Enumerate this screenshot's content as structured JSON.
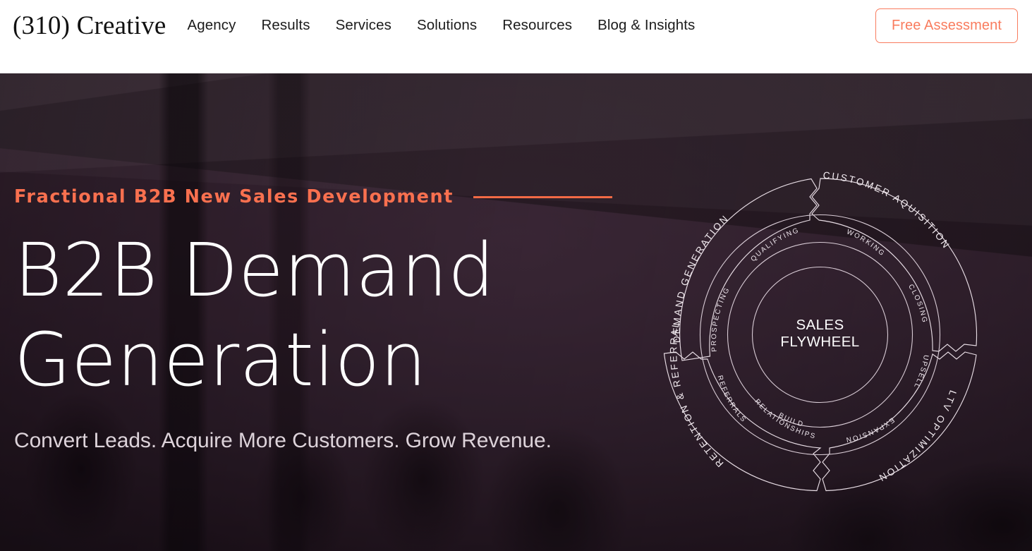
{
  "header": {
    "logo": "(310) Creative",
    "nav": [
      {
        "label": "Agency"
      },
      {
        "label": "Results"
      },
      {
        "label": "Services"
      },
      {
        "label": "Solutions"
      },
      {
        "label": "Resources"
      },
      {
        "label": "Blog & Insights"
      }
    ],
    "cta_label": "Free Assessment"
  },
  "hero": {
    "eyebrow": "Fractional B2B New Sales Development",
    "title_line1": "B2B Demand",
    "title_line2": "Generation",
    "subheading": "Convert Leads. Acquire More Customers. Grow Revenue."
  },
  "flywheel": {
    "center_line1": "SALES",
    "center_line2": "FLYWHEEL",
    "outer_segments": [
      {
        "label": "DEMAND GENERATION"
      },
      {
        "label": "CUSTOMER AQUISITION"
      },
      {
        "label": "LTV OPTIMIZATION"
      },
      {
        "label": "RETENTION & REFERRAL"
      }
    ],
    "inner_stages": [
      {
        "label": "PROSPECTING"
      },
      {
        "label": "QUALIFYING"
      },
      {
        "label": "WORKING"
      },
      {
        "label": "CLOSING"
      },
      {
        "label": "UPSELL"
      },
      {
        "label": "EXPANSION"
      },
      {
        "label": "BUILD"
      },
      {
        "label": "RELATIONSHIPS"
      },
      {
        "label": "REFERRALS"
      }
    ]
  },
  "colors": {
    "accent_coral": "#f9704f",
    "accent_coral_border": "#f97c5e",
    "hero_purple": "#3a2a36",
    "header_bg": "#ffffff",
    "text_dark": "#1c1c1c",
    "text_light": "#ffffff"
  }
}
